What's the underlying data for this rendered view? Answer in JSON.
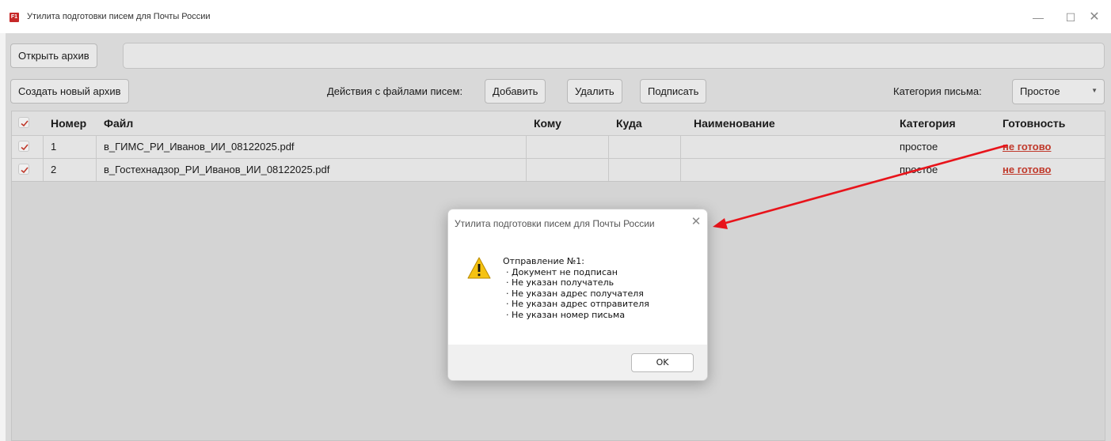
{
  "app": {
    "title": "Утилита подготовки писем для Почты России",
    "icon_label": "F1"
  },
  "window_controls": {
    "minimize": "—",
    "maximize": "☐",
    "close": "✕"
  },
  "toolbar": {
    "open_archive": "Открыть архив",
    "archive_path": "",
    "create_archive": "Создать новый архив",
    "file_actions_label": "Действия с файлами писем:",
    "add": "Добавить",
    "delete": "Удалить",
    "sign": "Подписать",
    "category_label": "Категория письма:",
    "category_value": "Простое"
  },
  "table": {
    "columns": {
      "number": "Номер",
      "file": "Файл",
      "to": "Кому",
      "where": "Куда",
      "name": "Наименование",
      "category": "Категория",
      "status": "Готовность"
    },
    "rows": [
      {
        "checked": true,
        "number": "1",
        "file": "в_ГИМС_РИ_Иванов_ИИ_08122025.pdf",
        "to": "",
        "where": "",
        "name": "",
        "category": "простое",
        "status": "не готово"
      },
      {
        "checked": true,
        "number": "2",
        "file": "в_Гостехнадзор_РИ_Иванов_ИИ_08122025.pdf",
        "to": "",
        "where": "",
        "name": "",
        "category": "простое",
        "status": "не готово"
      }
    ]
  },
  "dialog": {
    "title": "Утилита подготовки писем для Почты России",
    "heading": "Отправление №1:",
    "items": [
      "· Документ не подписан",
      "· Не указан получатель",
      "· Не указан адрес получателя",
      "· Не указан адрес отправителя",
      "· Не указан номер письма"
    ],
    "ok": "OK"
  },
  "colors": {
    "status_not_ready": "#c0392b",
    "annotation_arrow": "#e8141b",
    "warning_icon": "#f5c211"
  }
}
